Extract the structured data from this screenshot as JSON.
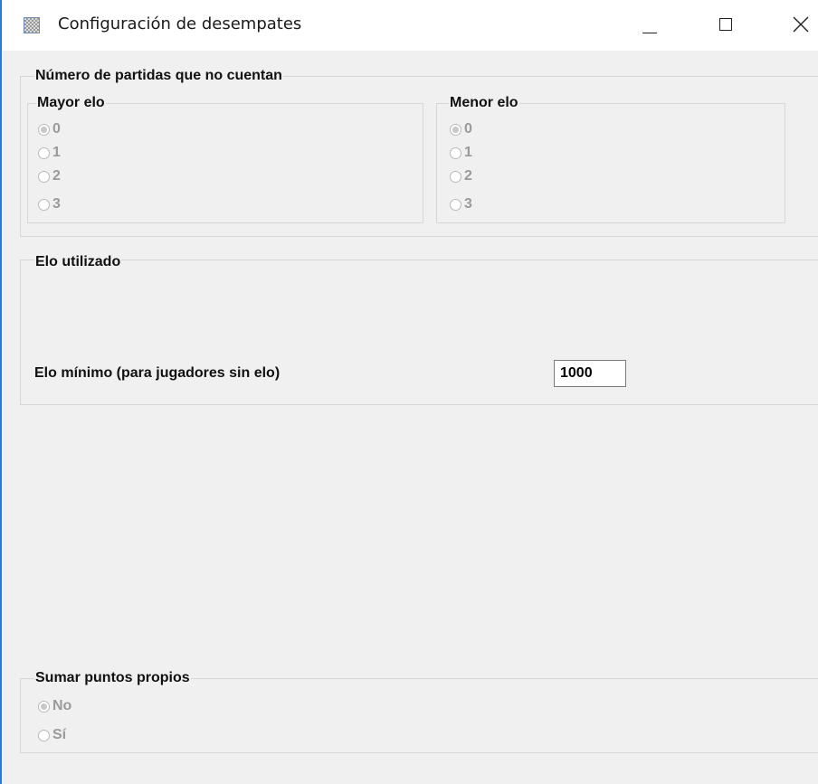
{
  "window": {
    "title": "Configuración de desempates"
  },
  "partidas": {
    "legend": "Número de partidas que no cuentan",
    "mayor": {
      "legend": "Mayor elo",
      "options": [
        "0",
        "1",
        "2",
        "3"
      ],
      "selected": "0"
    },
    "menor": {
      "legend": "Menor elo",
      "options": [
        "0",
        "1",
        "2",
        "3"
      ],
      "selected": "0"
    }
  },
  "elo": {
    "legend": "Elo utilizado",
    "minimo_label": "Elo mínimo (para jugadores sin elo)",
    "minimo_value": "1000"
  },
  "sumar": {
    "legend": "Sumar puntos propios",
    "options": [
      "No",
      "Sí"
    ],
    "selected": "No"
  }
}
